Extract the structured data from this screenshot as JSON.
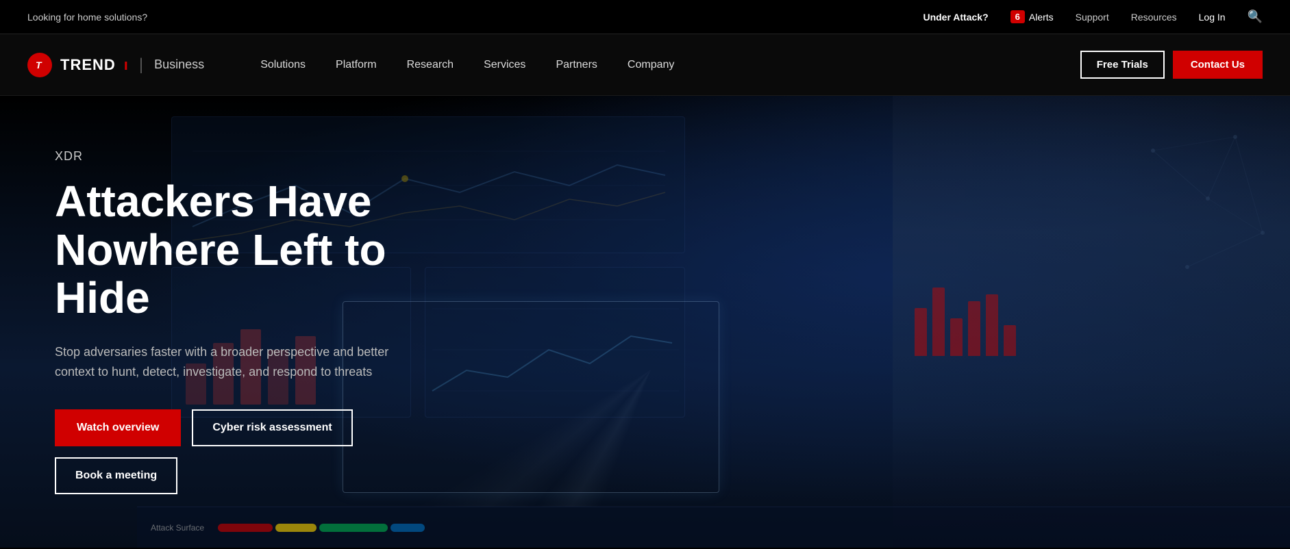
{
  "topbar": {
    "home_solutions": "Looking for home solutions?",
    "under_attack": "Under Attack?",
    "alerts_count": "6",
    "alerts_label": "Alerts",
    "support_label": "Support",
    "resources_label": "Resources",
    "login_label": "Log In"
  },
  "nav": {
    "logo_text": "TREND",
    "logo_suffix": "ı",
    "business_label": "Business",
    "solutions_label": "Solutions",
    "platform_label": "Platform",
    "research_label": "Research",
    "services_label": "Services",
    "partners_label": "Partners",
    "company_label": "Company",
    "free_trials_label": "Free Trials",
    "contact_us_label": "Contact Us"
  },
  "hero": {
    "eyebrow": "XDR",
    "headline": "Attackers Have Nowhere Left to Hide",
    "subtext": "Stop adversaries faster with a broader perspective and better context to hunt, detect, investigate, and respond to threats",
    "watch_overview": "Watch overview",
    "cyber_risk": "Cyber risk assessment",
    "book_meeting": "Book a meeting"
  },
  "attack_surface_label": "Attack Surface"
}
